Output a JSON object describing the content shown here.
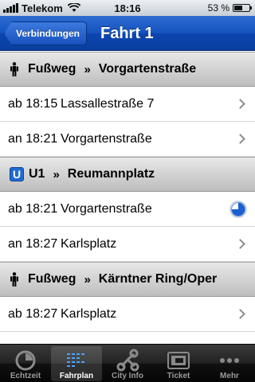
{
  "status_bar": {
    "carrier": "Telekom",
    "time": "18:16",
    "battery_percent": "53 %",
    "battery_level": 0.53
  },
  "nav": {
    "back_label": "Verbindungen",
    "title": "Fahrt 1"
  },
  "sections": [
    {
      "mode_icon": "walk-icon",
      "mode": "Fußweg",
      "separator": "»",
      "destination": "Vorgartenstraße",
      "rows": [
        {
          "time": "ab 18:15",
          "stop": "Lassallestraße 7",
          "accessory": "chevron-right-icon"
        },
        {
          "time": "an 18:21",
          "stop": "Vorgartenstraße",
          "accessory": "chevron-right-icon"
        }
      ]
    },
    {
      "mode_icon": "ubahn-icon",
      "mode_icon_letter": "U",
      "mode": "U1",
      "separator": "»",
      "destination": "Reumannplatz",
      "rows": [
        {
          "time": "ab 18:21",
          "stop": "Vorgartenstraße",
          "accessory": "pie-progress-icon",
          "progress": 0.75
        },
        {
          "time": "an 18:27",
          "stop": "Karlsplatz",
          "accessory": "chevron-right-icon"
        }
      ]
    },
    {
      "mode_icon": "walk-icon",
      "mode": "Fußweg",
      "separator": "»",
      "destination": "Kärntner Ring/Oper",
      "rows": [
        {
          "time": "ab 18:27",
          "stop": "Karlsplatz",
          "accessory": "chevron-right-icon"
        }
      ]
    }
  ],
  "tabbar": {
    "tabs": [
      {
        "label": "Echtzeit",
        "icon": "realtime-clock-icon",
        "active": false
      },
      {
        "label": "Fahrplan",
        "icon": "timetable-icon",
        "active": true
      },
      {
        "label": "City Info",
        "icon": "city-info-network-icon",
        "active": false
      },
      {
        "label": "Ticket",
        "icon": "ticket-icon",
        "active": false
      },
      {
        "label": "Mehr",
        "icon": "more-dots-icon",
        "active": false
      }
    ]
  },
  "colors": {
    "nav_blue": "#1553c0",
    "ubahn_blue": "#1f6bd2",
    "tab_inactive": "#9a9a9a"
  }
}
